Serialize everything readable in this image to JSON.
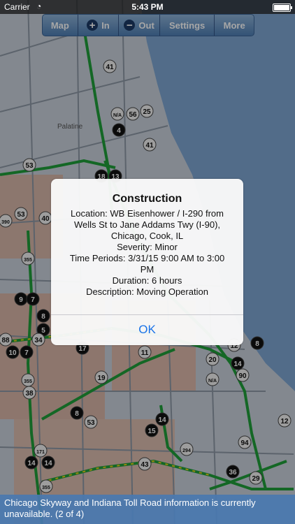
{
  "status_bar": {
    "carrier": "Carrier",
    "time": "5:43 PM"
  },
  "toolbar": {
    "map_label": "Map",
    "zoom_in_label": "In",
    "zoom_out_label": "Out",
    "settings_label": "Settings",
    "more_label": "More"
  },
  "alert": {
    "title": "Construction",
    "lines": [
      "Location: WB Eisenhower / I-290 from",
      "Wells St to Jane Addams Twy (I-90),",
      "Chicago, Cook, IL",
      "Severity: Minor",
      "Time Periods: 3/31/15 9:00 AM to 3:00",
      "PM",
      "Duration: 6 hours",
      "Description: Moving Operation"
    ],
    "ok_label": "OK"
  },
  "banner": {
    "text": "Chicago Skyway and Indiana Toll Road information is currently unavailable. (2 of 4)"
  },
  "map": {
    "place_labels": [
      "Palatine"
    ],
    "route_shields": [
      "41",
      "41",
      "25",
      "56",
      "N/A",
      "4",
      "53",
      "18",
      "13",
      "53",
      "40",
      "390",
      "355",
      "9",
      "7",
      "8",
      "5",
      "34",
      "88",
      "10",
      "7",
      "17",
      "11",
      "12",
      "8",
      "20",
      "14",
      "N/A",
      "90",
      "355",
      "38",
      "19",
      "8",
      "14",
      "15",
      "53",
      "12",
      "294",
      "94",
      "171",
      "14",
      "14",
      "43",
      "36",
      "29",
      "355"
    ]
  }
}
